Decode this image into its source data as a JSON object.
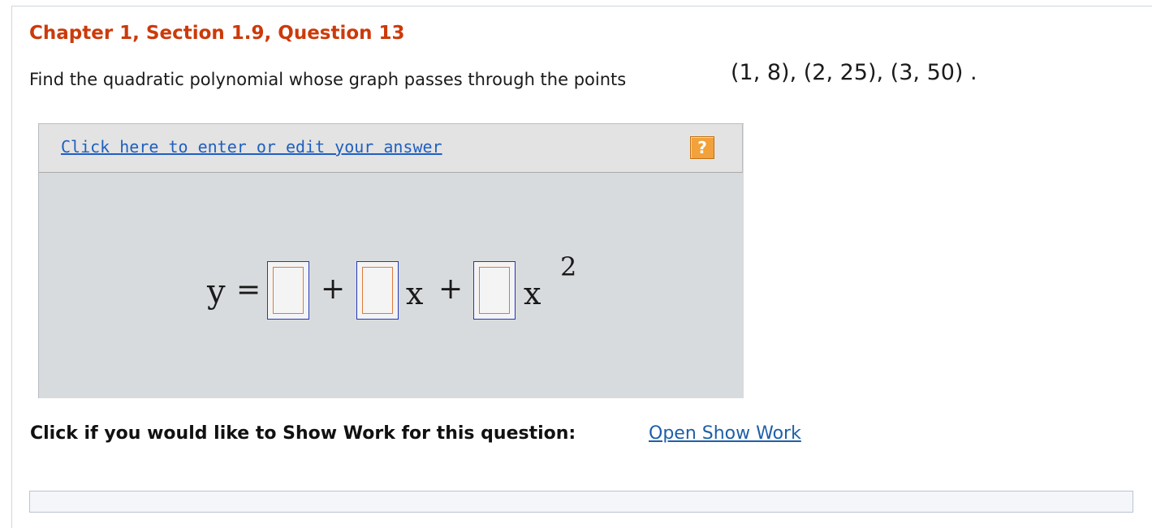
{
  "question": {
    "title": "Chapter 1, Section 1.9, Question 13",
    "prompt": "Find the quadratic polynomial whose graph passes through the points",
    "points": "(1, 8), (2, 25), (3, 50) ."
  },
  "answer_panel": {
    "edit_link": "Click here to enter or edit your answer",
    "help_label": "?",
    "equation": {
      "y": "y",
      "equals": "=",
      "plus1": "+",
      "x1": "x",
      "plus2": "+",
      "x2": "x",
      "exponent": "2",
      "coefficients": [
        "",
        "",
        ""
      ]
    }
  },
  "show_work": {
    "label": "Click if you would like to Show Work for this question:",
    "link": "Open Show Work"
  },
  "colors": {
    "title": "#cc3a0a",
    "link": "#1f5fbf",
    "box_outer": "#2438b8",
    "box_inner": "#e07a3a",
    "help_button": "#f3a13a"
  },
  "icons": {
    "help": "question-mark-icon"
  }
}
